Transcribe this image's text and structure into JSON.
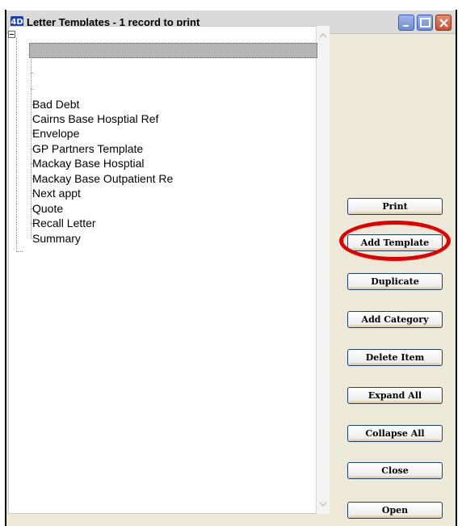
{
  "window": {
    "app_icon": "4D",
    "title": "Letter Templates - 1 record to print"
  },
  "tree": {
    "items": [
      "Bad Debt",
      "Cairns Base Hosptial Ref",
      "Envelope",
      "GP Partners Template",
      "Mackay Base Hosptial",
      "Mackay Base Outpatient Re",
      "Next appt",
      "Quote",
      "Recall Letter",
      "Summary"
    ]
  },
  "buttons": {
    "print": "Print",
    "add_template": "Add Template",
    "duplicate": "Duplicate",
    "add_category": "Add Category",
    "delete_item": "Delete Item",
    "expand_all": "Expand All",
    "collapse_all": "Collapse All",
    "close": "Close",
    "open": "Open"
  },
  "colors": {
    "annotation_ring": "#e00000",
    "button_border": "#1f3f7a"
  }
}
